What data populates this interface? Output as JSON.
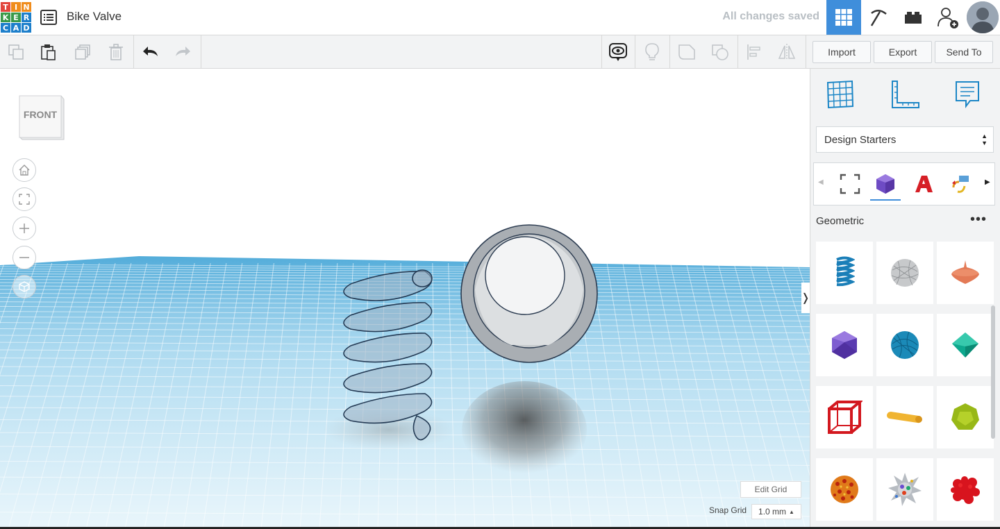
{
  "app": {
    "logo_letters": [
      "T",
      "I",
      "N",
      "K",
      "E",
      "R",
      "C",
      "A",
      "D"
    ],
    "logo_colors": [
      "#e2463c",
      "#f08c1c",
      "#f08c1c",
      "#3a9a4a",
      "#3a9a4a",
      "#1d7fcb",
      "#1d7fcb",
      "#1d7fcb",
      "#1d7fcb"
    ],
    "design_title": "Bike Valve",
    "save_status": "All changes saved"
  },
  "toolbar": {
    "import_label": "Import",
    "export_label": "Export",
    "send_to_label": "Send To"
  },
  "viewcube": {
    "face_label": "FRONT"
  },
  "grid": {
    "edit_grid_label": "Edit Grid",
    "snap_grid_label": "Snap Grid",
    "snap_grid_value": "1.0 mm"
  },
  "panel": {
    "library_selected": "Design Starters",
    "category_title": "Geometric",
    "more_label": "•••"
  },
  "colors": {
    "accent": "#3f8edb",
    "grid_blue": "#7cc6e6",
    "spring_blue": "#1b7fb8"
  }
}
